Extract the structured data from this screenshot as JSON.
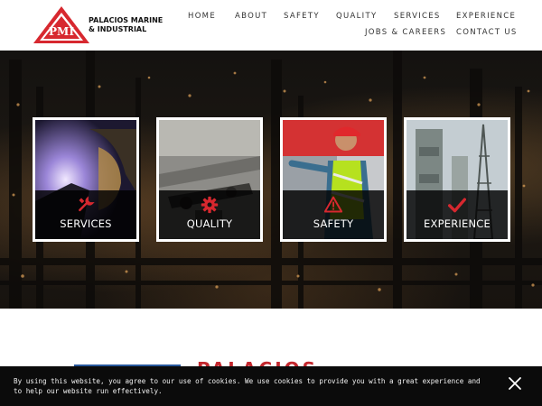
{
  "header": {
    "brand_line1": "PALACIOS MARINE",
    "brand_line2": "& INDUSTRIAL",
    "logo_monogram": "PMI",
    "nav": [
      "HOME",
      "ABOUT",
      "SAFETY",
      "QUALITY",
      "SERVICES",
      "EXPERIENCE",
      "JOBS & CAREERS",
      "CONTACT US"
    ]
  },
  "hero": {
    "cards": [
      {
        "label": "SERVICES",
        "icon": "wrench-icon"
      },
      {
        "label": "QUALITY",
        "icon": "gear-icon"
      },
      {
        "label": "SAFETY",
        "icon": "warning-triangle-icon"
      },
      {
        "label": "EXPERIENCE",
        "icon": "checkmark-icon"
      }
    ]
  },
  "partial_heading": "PALACIOS MARINE &",
  "cookie": {
    "text": "By using this website, you agree to our use of cookies. We use cookies to provide you with a great experience and to help our website run effectively."
  },
  "colors": {
    "accent_red": "#d7282f",
    "header_bg": "#ffffff",
    "cookie_bg": "#0b0b0b"
  }
}
